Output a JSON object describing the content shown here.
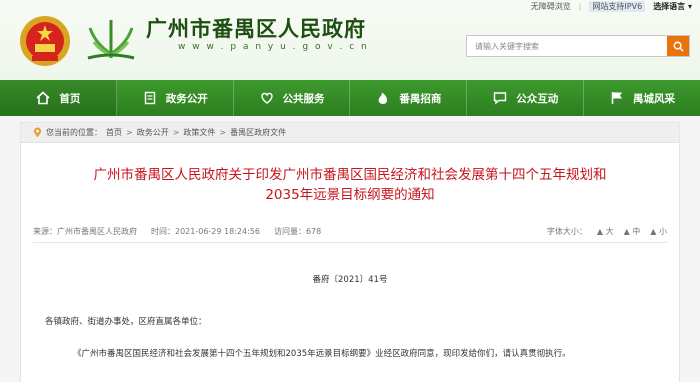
{
  "topbar": {
    "accessibility": "无障碍浏览",
    "ipv6": "网站支持IPV6",
    "language": "选择语言 ▾"
  },
  "site": {
    "title": "广州市番禺区人民政府",
    "url": "w w w . p a n y u . g o v . c n"
  },
  "search": {
    "placeholder": "请输入关键字搜索",
    "icon": "search-icon"
  },
  "nav": {
    "items": [
      {
        "label": "首页",
        "icon": "home-icon"
      },
      {
        "label": "政务公开",
        "icon": "document-icon"
      },
      {
        "label": "公共服务",
        "icon": "heart-icon"
      },
      {
        "label": "番禺招商",
        "icon": "flame-icon"
      },
      {
        "label": "公众互动",
        "icon": "chat-icon"
      },
      {
        "label": "禺城风采",
        "icon": "flag-icon"
      }
    ]
  },
  "breadcrumb": {
    "prefix": "您当前的位置：",
    "items": [
      "首页",
      "政务公开",
      "政策文件",
      "番禺区政府文件"
    ]
  },
  "article": {
    "title": "广州市番禺区人民政府关于印发广州市番禺区国民经济和社会发展第十四个五年规划和2035年远景目标纲要的通知",
    "source": "来源：广州市番禺区人民政府",
    "time": "时间：2021-06-29 18:24:56",
    "views": "访问量：678",
    "font_size_label": "字体大小：",
    "font_sizes": [
      "大",
      "中",
      "小"
    ],
    "doc_no": "番府〔2021〕41号",
    "salutation": "各镇政府、街道办事处，区府直属各单位：",
    "body": "《广州市番禺区国民经济和社会发展第十四个五年规划和2035年远景目标纲要》业经区政府同意，现印发给你们，请认真贯彻执行。"
  },
  "colors": {
    "nav_green": "#2f8a21",
    "title_red": "#c4161c",
    "search_orange": "#e8730a"
  }
}
